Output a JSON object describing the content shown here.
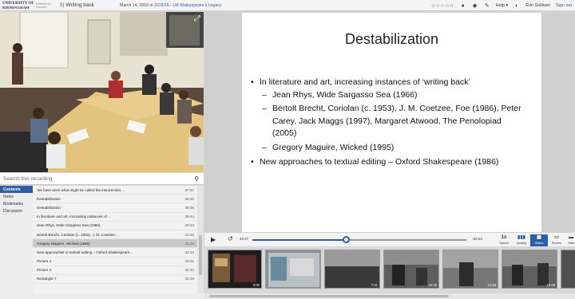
{
  "header": {
    "logo_line1": "UNIVERSITY OF",
    "logo_line2": "BIRMINGHAM",
    "powered_by": "Powered by Panopto",
    "back_count": "9)",
    "recording_title": "Writing back",
    "date": "March 14, 2016 in",
    "course_link": "2015/16 - LM Shakespeare's Legacy",
    "stars": "☆☆☆☆☆",
    "help_label": "Help",
    "user_name": "Erin Sullivan",
    "signout_label": "Sign out"
  },
  "search": {
    "placeholder": "Search this recording"
  },
  "side_tabs": [
    {
      "label": "Contents",
      "active": true
    },
    {
      "label": "Notes",
      "active": false
    },
    {
      "label": "Bookmarks",
      "active": false
    },
    {
      "label": "Discussion",
      "active": false
    }
  ],
  "toc": [
    {
      "title": "'we have seen what might be called the insurrection...",
      "time": "37:37",
      "selected": false
    },
    {
      "title": "Destabilization",
      "time": "38:35",
      "selected": false
    },
    {
      "title": "Destabilization",
      "time": "38:36",
      "selected": false
    },
    {
      "title": "In literature and art, increasing instances of ...",
      "time": "39:43",
      "selected": false
    },
    {
      "title": "Jean Rhys, Wide Sargasso Sea (1966)",
      "time": "40:13",
      "selected": false
    },
    {
      "title": "Bertolt Brecht, Coriolan (c. 1953), J. M. Coetzee...",
      "time": "41:30",
      "selected": false
    },
    {
      "title": "Gregory Maguire, Wicked (1995)",
      "time": "41:44",
      "selected": true
    },
    {
      "title": "New approaches to textual editing – Oxford Shakespeare...",
      "time": "42:23",
      "selected": false
    },
    {
      "title": "Picture 4",
      "time": "42:31",
      "selected": false
    },
    {
      "title": "Picture 2",
      "time": "42:33",
      "selected": false
    },
    {
      "title": "Rectangle 7",
      "time": "42:38",
      "selected": false
    }
  ],
  "slide": {
    "title": "Destabilization",
    "b1": "In literature and art, increasing instances of ‘writing back’",
    "s1": "Jean Rhys, Wide Sargasso Sea (1966)",
    "s2": "Bertolt Brecht, Coriolan (c. 1953), J. M. Coetzee, Foe (1986), Peter Carey, Jack Maggs (1997), Margaret Atwood, The Penolopiad (2005)",
    "s3": "Gregory Maguire, Wicked (1995)",
    "b2": "New approaches to textual editing – Oxford Shakespeare (1986)"
  },
  "player": {
    "time_elapsed": "40:47",
    "time_remaining": "-52:53",
    "progress_percent": 44,
    "speed_value": "1x",
    "speed_label": "Speed",
    "quality_label": "Quality",
    "slides_label": "Slides",
    "screen_label": "Screen",
    "hide_label": "Hide"
  },
  "thumbnails": [
    {
      "time": "0:00",
      "color": "#3a3a3a"
    },
    {
      "time": "",
      "color": "#6c7478"
    },
    {
      "time": "7:21",
      "color": "#6a6a6a"
    },
    {
      "time": "10:28",
      "color": "#5e5e5e"
    },
    {
      "time": "13:28",
      "color": "#777777"
    },
    {
      "time": "16:28",
      "color": "#606060"
    },
    {
      "time": "",
      "color": "#505050"
    }
  ],
  "colors": {
    "accent": "#2b5fa6",
    "link": "#2a5ea8"
  }
}
